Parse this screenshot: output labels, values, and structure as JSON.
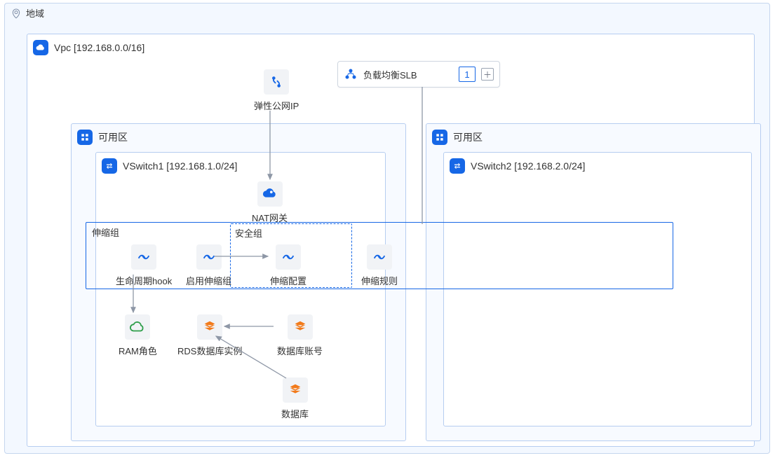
{
  "region": {
    "label": "地域"
  },
  "vpc": {
    "label": "Vpc [192.168.0.0/16]"
  },
  "slb": {
    "label": "负载均衡SLB",
    "count": "1"
  },
  "eip": {
    "label": "弹性公网IP"
  },
  "az1": {
    "label": "可用区"
  },
  "az2": {
    "label": "可用区"
  },
  "vswitch1": {
    "label": "VSwitch1 [192.168.1.0/24]"
  },
  "vswitch2": {
    "label": "VSwitch2 [192.168.2.0/24]"
  },
  "nat": {
    "label": "NAT网关"
  },
  "scaling_group": {
    "label": "伸缩组"
  },
  "security_group": {
    "label": "安全组"
  },
  "nodes": {
    "lifecycle_hook": "生命周期hook",
    "enable_scaling_group": "启用伸缩组",
    "scaling_config": "伸缩配置",
    "scaling_rule": "伸缩规则",
    "ram_role": "RAM角色",
    "rds_instance": "RDS数据库实例",
    "db_account": "数据库账号",
    "database": "数据库"
  }
}
